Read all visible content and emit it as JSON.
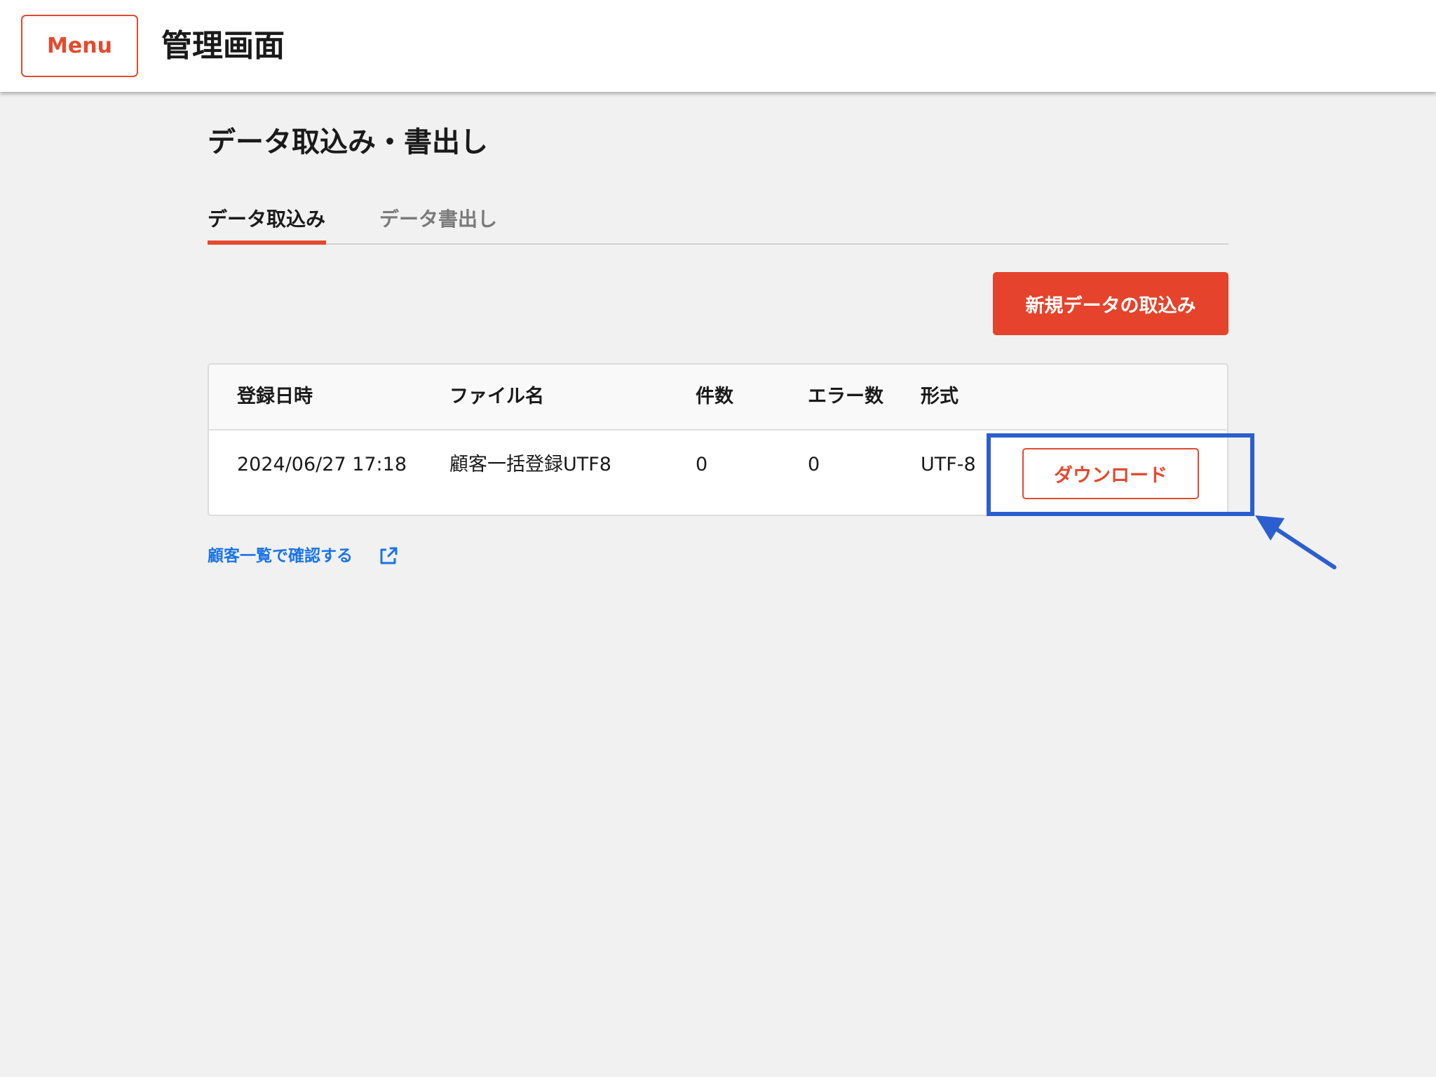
{
  "header": {
    "menu_label": "Menu",
    "app_title": "管理画面"
  },
  "main": {
    "page_title": "データ取込み・書出し",
    "tabs": [
      {
        "label": "データ取込み",
        "active": true
      },
      {
        "label": "データ書出し",
        "active": false
      }
    ],
    "new_import_label": "新規データの取込み",
    "table": {
      "columns": [
        "登録日時",
        "ファイル名",
        "件数",
        "エラー数",
        "形式"
      ],
      "rows": [
        {
          "registered_at": "2024/06/27 17:18",
          "file_name": "顧客一括登録UTF8",
          "count": "0",
          "error_count": "0",
          "format": "UTF-8",
          "download_label": "ダウンロード"
        }
      ]
    },
    "customer_link_label": "顧客一覧で確認する",
    "link_icon": "external-link-icon"
  },
  "colors": {
    "accent": "#e34a2f",
    "link": "#1a73e8",
    "annotation": "#2b5fcf",
    "background": "#f1f1f1"
  }
}
